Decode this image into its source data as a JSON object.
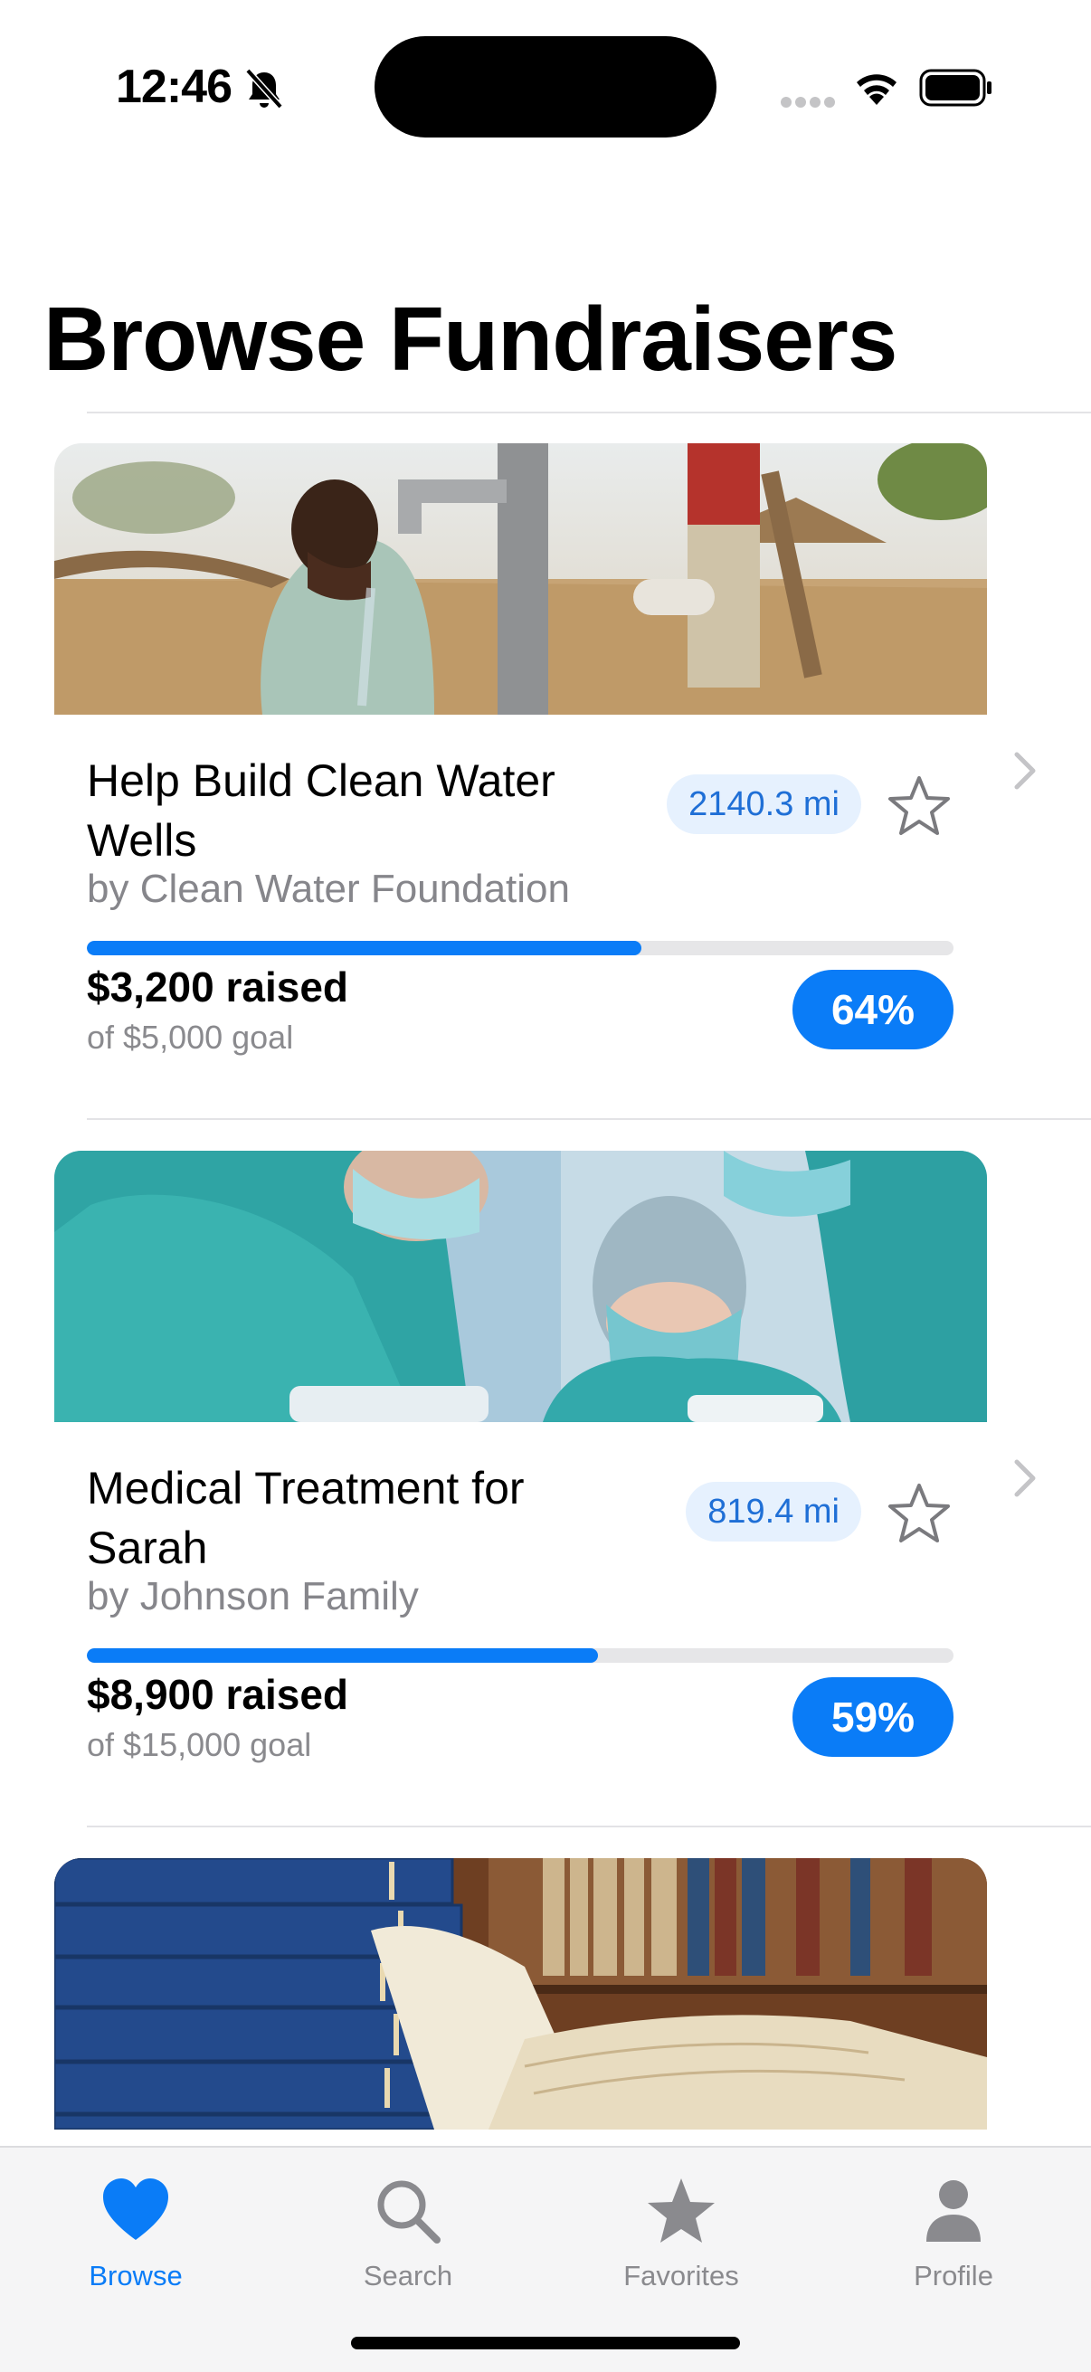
{
  "status_bar": {
    "time": "12:46"
  },
  "page": {
    "title": "Browse Fundraisers"
  },
  "fundraisers": [
    {
      "title": "Help Build Clean Water Wells",
      "organizer": "by Clean Water Foundation",
      "distance": "2140.3 mi",
      "raised": "$3,200 raised",
      "goal": "of $5,000 goal",
      "percent_label": "64%",
      "progress": 0.64,
      "image_icon": "water-well-photo"
    },
    {
      "title": "Medical Treatment for Sarah",
      "organizer": "by Johnson Family",
      "distance": "819.4 mi",
      "raised": "$8,900 raised",
      "goal": "of $15,000 goal",
      "percent_label": "59%",
      "progress": 0.59,
      "image_icon": "surgery-photo"
    },
    {
      "image_icon": "library-books-photo"
    }
  ],
  "tab_bar": {
    "items": [
      {
        "label": "Browse",
        "icon": "heart-icon",
        "active": true
      },
      {
        "label": "Search",
        "icon": "search-icon",
        "active": false
      },
      {
        "label": "Favorites",
        "icon": "star-icon",
        "active": false
      },
      {
        "label": "Profile",
        "icon": "person-icon",
        "active": false
      }
    ]
  },
  "colors": {
    "accent": "#0A7CF7",
    "distance_badge_bg": "#E6F1FE",
    "secondary_text": "#86868B"
  }
}
